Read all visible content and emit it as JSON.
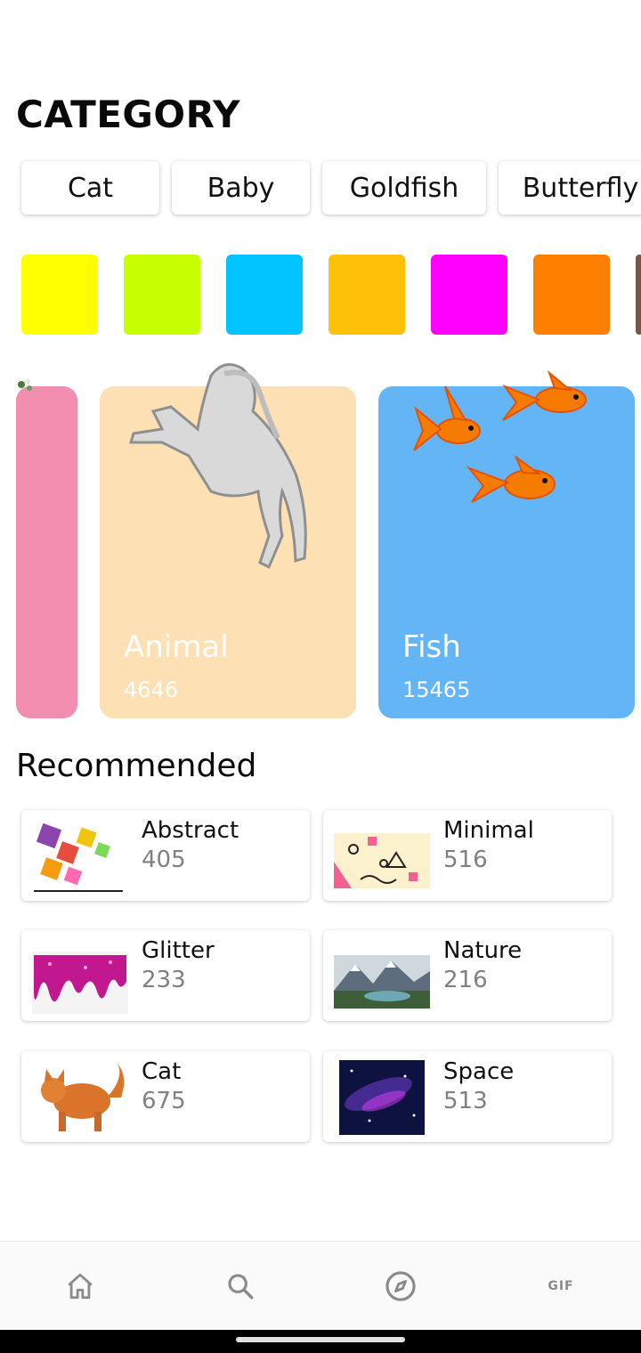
{
  "header": {
    "title": "CATEGORY"
  },
  "chips": [
    {
      "label": "Cat"
    },
    {
      "label": "Baby"
    },
    {
      "label": "Goldfish"
    },
    {
      "label": "Butterfly"
    }
  ],
  "swatches": [
    {
      "color": "#ffff00"
    },
    {
      "color": "#c6ff00"
    },
    {
      "color": "#00c4ff"
    },
    {
      "color": "#ffc107"
    },
    {
      "color": "#ff00ff"
    },
    {
      "color": "#ff8000"
    },
    {
      "color": "#795548"
    }
  ],
  "cards": [
    {
      "name": "",
      "count": "",
      "color": "#f28fb1"
    },
    {
      "name": "Animal",
      "count": "4646",
      "color": "#fde0b3"
    },
    {
      "name": "Fish",
      "count": "15465",
      "color": "#64b5f6"
    }
  ],
  "recommended": {
    "title": "Recommended",
    "items": [
      {
        "name": "Abstract",
        "count": "405"
      },
      {
        "name": "Minimal",
        "count": "516"
      },
      {
        "name": "Glitter",
        "count": "233"
      },
      {
        "name": "Nature",
        "count": "216"
      },
      {
        "name": "Cat",
        "count": "675"
      },
      {
        "name": "Space",
        "count": "513"
      }
    ]
  },
  "nav": {
    "items": [
      {
        "icon": "home-icon"
      },
      {
        "icon": "search-icon"
      },
      {
        "icon": "compass-icon"
      },
      {
        "icon": "gif-icon",
        "label": "GIF"
      }
    ]
  }
}
